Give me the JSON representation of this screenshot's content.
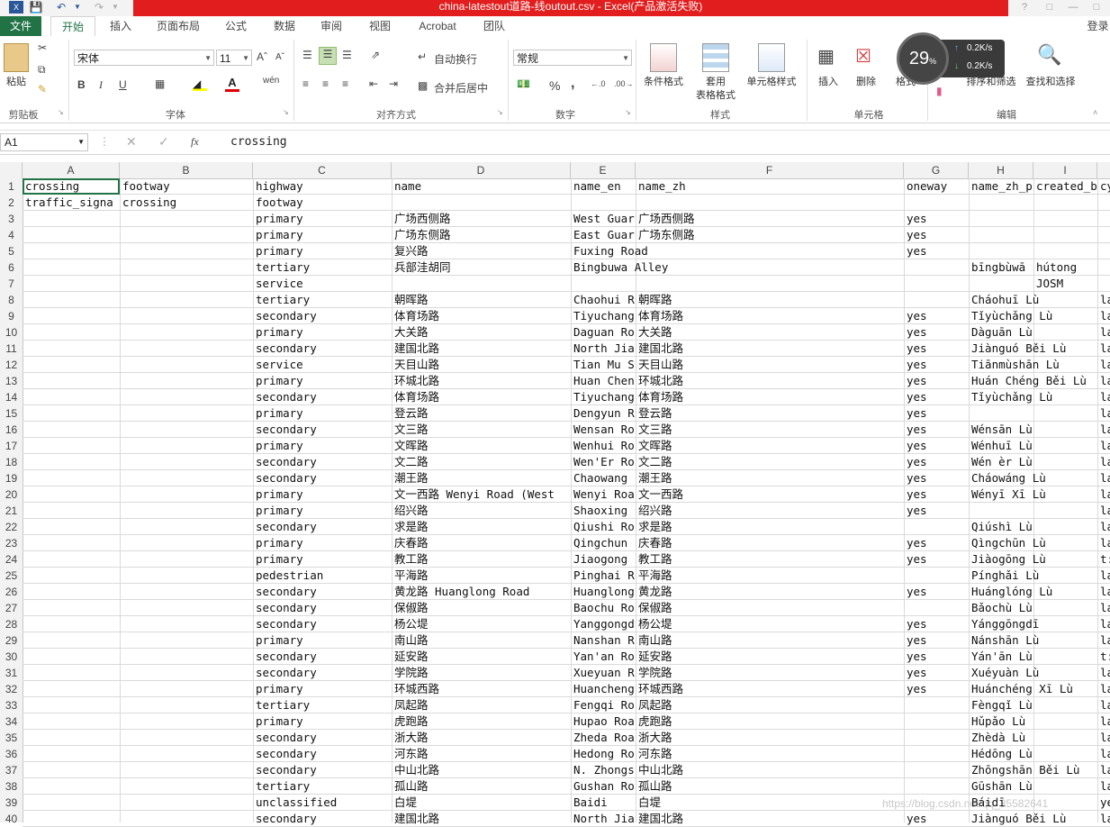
{
  "window": {
    "title": "china-latestout道路-线outout.csv -  Excel(产品激活失败)",
    "login": "登录",
    "help": "?"
  },
  "tabs": [
    "文件",
    "开始",
    "插入",
    "页面布局",
    "公式",
    "数据",
    "审阅",
    "视图",
    "Acrobat",
    "团队"
  ],
  "ribbon": {
    "clipboard": {
      "paste": "粘贴",
      "label": "剪贴板"
    },
    "font": {
      "name": "宋体",
      "size": "11",
      "label": "字体",
      "bold": "B",
      "italic": "I",
      "underline": "U",
      "phonetic": "wén"
    },
    "alignment": {
      "wrap": "自动换行",
      "merge": "合并后居中",
      "label": "对齐方式"
    },
    "number": {
      "format": "常规",
      "percent": "%",
      "comma": ",",
      "label": "数字"
    },
    "styles": {
      "conditional": "条件格式",
      "table1": "套用",
      "table2": "表格格式",
      "cell_styles": "单元格样式",
      "label": "样式"
    },
    "cells": {
      "insert": "插入",
      "delete": "删除",
      "format": "格式",
      "label": "单元格"
    },
    "editing": {
      "sort": "排序和筛选",
      "find": "查找和选择",
      "label": "编辑"
    }
  },
  "speed_widget": {
    "percent": "29",
    "percent_sign": "%",
    "up": "0.2K/s",
    "down": "0.2K/s"
  },
  "formula_bar": {
    "cell_ref": "A1",
    "fx": "fx",
    "content": "crossing"
  },
  "columns": [
    "A",
    "B",
    "C",
    "D",
    "E",
    "F",
    "G",
    "H",
    "I"
  ],
  "rows": [
    {
      "n": "1",
      "a": "crossing",
      "b": "footway",
      "c": "highway",
      "d": "name",
      "e": "name_en",
      "f": "name_zh",
      "g": "oneway",
      "h": "name_zh_p",
      "i": "created_b",
      "j": "cy"
    },
    {
      "n": "2",
      "a": "traffic_signa",
      "b": "crossing",
      "c": "footway",
      "d": "",
      "e": "",
      "f": "",
      "g": "",
      "h": "",
      "i": "",
      "j": ""
    },
    {
      "n": "3",
      "a": "",
      "b": "",
      "c": "primary",
      "d": "广场西侧路",
      "e": "West Guar",
      "f": "广场西侧路",
      "g": "yes",
      "h": "",
      "i": "",
      "j": ""
    },
    {
      "n": "4",
      "a": "",
      "b": "",
      "c": "primary",
      "d": "广场东侧路",
      "e": "East Guar",
      "f": "广场东侧路",
      "g": "yes",
      "h": "",
      "i": "",
      "j": ""
    },
    {
      "n": "5",
      "a": "",
      "b": "",
      "c": "primary",
      "d": "复兴路",
      "e": "Fuxing Road",
      "f": "",
      "g": "yes",
      "h": "",
      "i": "",
      "j": ""
    },
    {
      "n": "6",
      "a": "",
      "b": "",
      "c": "tertiary",
      "d": "兵部洼胡同",
      "e": "Bingbuwa Alley",
      "f": "",
      "g": "",
      "h": "bīngbùwā",
      "i": "hútong",
      "j": ""
    },
    {
      "n": "7",
      "a": "",
      "b": "",
      "c": "service",
      "d": "",
      "e": "",
      "f": "",
      "g": "",
      "h": "",
      "i": "JOSM",
      "j": ""
    },
    {
      "n": "8",
      "a": "",
      "b": "",
      "c": "tertiary",
      "d": "朝晖路",
      "e": "Chaohui R",
      "f": "朝晖路",
      "g": "",
      "h": "Cháohuī Lù",
      "i": "",
      "j": "la"
    },
    {
      "n": "9",
      "a": "",
      "b": "",
      "c": "secondary",
      "d": "体育场路",
      "e": "Tiyuchang",
      "f": "体育场路",
      "g": "yes",
      "h": "Tǐyùchǎng Lù",
      "i": "",
      "j": "la"
    },
    {
      "n": "10",
      "a": "",
      "b": "",
      "c": "primary",
      "d": "大关路",
      "e": "Daguan Ro",
      "f": "大关路",
      "g": "yes",
      "h": "Dàguān Lù",
      "i": "",
      "j": "la"
    },
    {
      "n": "11",
      "a": "",
      "b": "",
      "c": "secondary",
      "d": "建国北路",
      "e": "North Jia",
      "f": "建国北路",
      "g": "yes",
      "h": "Jiànguó Běi Lù",
      "i": "",
      "j": "la"
    },
    {
      "n": "12",
      "a": "",
      "b": "",
      "c": "service",
      "d": "天目山路",
      "e": "Tian Mu S",
      "f": "天目山路",
      "g": "yes",
      "h": "Tiānmùshān Lù",
      "i": "",
      "j": "la"
    },
    {
      "n": "13",
      "a": "",
      "b": "",
      "c": "primary",
      "d": "环城北路",
      "e": "Huan Chen",
      "f": "环城北路",
      "g": "yes",
      "h": "Huán Chéng Běi Lù",
      "i": "",
      "j": "la"
    },
    {
      "n": "14",
      "a": "",
      "b": "",
      "c": "secondary",
      "d": "体育场路",
      "e": "Tiyuchang",
      "f": "体育场路",
      "g": "yes",
      "h": "Tǐyùchǎng Lù",
      "i": "",
      "j": "la"
    },
    {
      "n": "15",
      "a": "",
      "b": "",
      "c": "primary",
      "d": "登云路",
      "e": "Dengyun R",
      "f": "登云路",
      "g": "yes",
      "h": "",
      "i": "",
      "j": "la"
    },
    {
      "n": "16",
      "a": "",
      "b": "",
      "c": "secondary",
      "d": "文三路",
      "e": "Wensan Ro",
      "f": "文三路",
      "g": "yes",
      "h": "Wénsān Lù",
      "i": "",
      "j": "la"
    },
    {
      "n": "17",
      "a": "",
      "b": "",
      "c": "primary",
      "d": "文晖路",
      "e": "Wenhui Ro",
      "f": "文晖路",
      "g": "yes",
      "h": "Wénhuī Lù",
      "i": "",
      "j": "la"
    },
    {
      "n": "18",
      "a": "",
      "b": "",
      "c": "secondary",
      "d": "文二路",
      "e": "Wen'Er Ro",
      "f": "文二路",
      "g": "yes",
      "h": "Wén èr Lù",
      "i": "",
      "j": "la"
    },
    {
      "n": "19",
      "a": "",
      "b": "",
      "c": "secondary",
      "d": "潮王路",
      "e": "Chaowang",
      "f": "潮王路",
      "g": "yes",
      "h": "Cháowáng Lù",
      "i": "",
      "j": "la"
    },
    {
      "n": "20",
      "a": "",
      "b": "",
      "c": "primary",
      "d": "文一西路 Wenyi Road (West",
      "e": "Wenyi Roa",
      "f": "文一西路",
      "g": "yes",
      "h": "Wényī Xī Lù",
      "i": "",
      "j": "la"
    },
    {
      "n": "21",
      "a": "",
      "b": "",
      "c": "primary",
      "d": "绍兴路",
      "e": "Shaoxing",
      "f": "绍兴路",
      "g": "yes",
      "h": "",
      "i": "",
      "j": "la"
    },
    {
      "n": "22",
      "a": "",
      "b": "",
      "c": "secondary",
      "d": "求是路",
      "e": "Qiushi Ro",
      "f": "求是路",
      "g": "",
      "h": "Qiúshì Lù",
      "i": "",
      "j": "la"
    },
    {
      "n": "23",
      "a": "",
      "b": "",
      "c": "primary",
      "d": "庆春路",
      "e": "Qingchun",
      "f": "庆春路",
      "g": "yes",
      "h": "Qìngchūn Lù",
      "i": "",
      "j": "la"
    },
    {
      "n": "24",
      "a": "",
      "b": "",
      "c": "primary",
      "d": "教工路",
      "e": "Jiaogong",
      "f": "教工路",
      "g": "yes",
      "h": "Jiàogōng Lù",
      "i": "",
      "j": "t:"
    },
    {
      "n": "25",
      "a": "",
      "b": "",
      "c": "pedestrian",
      "d": "平海路",
      "e": "Pinghai R",
      "f": "平海路",
      "g": "",
      "h": "Pínghǎi Lù",
      "i": "",
      "j": "la"
    },
    {
      "n": "26",
      "a": "",
      "b": "",
      "c": "secondary",
      "d": "黄龙路 Huanglong Road",
      "e": "Huanglong",
      "f": "黄龙路",
      "g": "yes",
      "h": "Huánglóng Lù",
      "i": "",
      "j": "la"
    },
    {
      "n": "27",
      "a": "",
      "b": "",
      "c": "secondary",
      "d": "保俶路",
      "e": "Baochu Ro",
      "f": "保俶路",
      "g": "",
      "h": "Bǎochù Lù",
      "i": "",
      "j": "la"
    },
    {
      "n": "28",
      "a": "",
      "b": "",
      "c": "secondary",
      "d": "杨公堤",
      "e": "Yanggongd",
      "f": "杨公堤",
      "g": "yes",
      "h": "Yánggōngdī",
      "i": "",
      "j": "la"
    },
    {
      "n": "29",
      "a": "",
      "b": "",
      "c": "primary",
      "d": "南山路",
      "e": "Nanshan R",
      "f": "南山路",
      "g": "yes",
      "h": "Nánshān Lù",
      "i": "",
      "j": "la"
    },
    {
      "n": "30",
      "a": "",
      "b": "",
      "c": "secondary",
      "d": "延安路",
      "e": "Yan'an Ro",
      "f": "延安路",
      "g": "yes",
      "h": "Yán'ān Lù",
      "i": "",
      "j": "t:"
    },
    {
      "n": "31",
      "a": "",
      "b": "",
      "c": "secondary",
      "d": "学院路",
      "e": "Xueyuan R",
      "f": "学院路",
      "g": "yes",
      "h": "Xuéyuàn Lù",
      "i": "",
      "j": "la"
    },
    {
      "n": "32",
      "a": "",
      "b": "",
      "c": "primary",
      "d": "环城西路",
      "e": "Huancheng",
      "f": "环城西路",
      "g": "yes",
      "h": "Huánchéng Xī Lù",
      "i": "",
      "j": "la"
    },
    {
      "n": "33",
      "a": "",
      "b": "",
      "c": "tertiary",
      "d": "凤起路",
      "e": "Fengqi Ro",
      "f": "凤起路",
      "g": "",
      "h": "Fèngqǐ Lù",
      "i": "",
      "j": "la"
    },
    {
      "n": "34",
      "a": "",
      "b": "",
      "c": "primary",
      "d": "虎跑路",
      "e": "Hupao Roa",
      "f": "虎跑路",
      "g": "",
      "h": "Hǔpǎo Lù",
      "i": "",
      "j": "la"
    },
    {
      "n": "35",
      "a": "",
      "b": "",
      "c": "secondary",
      "d": "浙大路",
      "e": "Zheda Roa",
      "f": "浙大路",
      "g": "",
      "h": "Zhèdà Lù",
      "i": "",
      "j": "la"
    },
    {
      "n": "36",
      "a": "",
      "b": "",
      "c": "secondary",
      "d": "河东路",
      "e": "Hedong Ro",
      "f": "河东路",
      "g": "",
      "h": "Hédōng Lù",
      "i": "",
      "j": "la"
    },
    {
      "n": "37",
      "a": "",
      "b": "",
      "c": "secondary",
      "d": "中山北路",
      "e": "N. Zhongs",
      "f": "中山北路",
      "g": "",
      "h": "Zhōngshān Běi Lù",
      "i": "",
      "j": "la"
    },
    {
      "n": "38",
      "a": "",
      "b": "",
      "c": "tertiary",
      "d": "孤山路",
      "e": "Gushan Ro",
      "f": "孤山路",
      "g": "",
      "h": "Gūshān Lù",
      "i": "",
      "j": "la"
    },
    {
      "n": "39",
      "a": "",
      "b": "",
      "c": "unclassified",
      "d": "白堤",
      "e": "Baidi",
      "f": "白堤",
      "g": "",
      "h": "Báidī",
      "i": "",
      "j": "ye"
    },
    {
      "n": "40",
      "a": "",
      "b": "",
      "c": "secondary",
      "d": "建国北路",
      "e": "North Jia",
      "f": "建国北路",
      "g": "yes",
      "h": "Jiànguó Běi Lù",
      "i": "",
      "j": "la"
    }
  ],
  "watermark": "https://blog.csdn.net/qq_35582641"
}
